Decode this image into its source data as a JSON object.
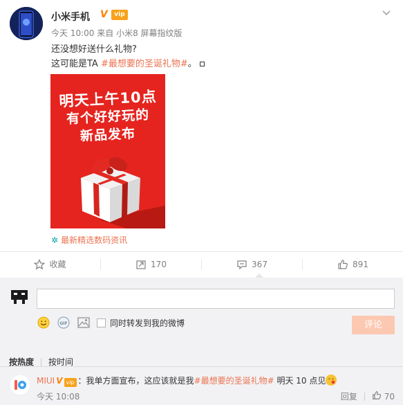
{
  "post": {
    "author": "小米手机",
    "verified_mark": "V",
    "vip_label": "vip",
    "meta_time": "今天 10:00",
    "meta_from": "来自",
    "meta_source": "小米8 屏幕指纹版",
    "text_line1": "还没想好送什么礼物?",
    "text_line2_prefix": "这可能是TA ",
    "topic": "#最想要的圣诞礼物#",
    "text_line2_suffix": "。",
    "image_lines": [
      "明天上午10点",
      "有个好好玩的",
      "新品发布"
    ],
    "image_source_icon": "✲",
    "image_source": "最新精选数码资讯"
  },
  "actions": {
    "favorite_label": "收藏",
    "repost_count": "170",
    "comment_count": "367",
    "like_count": "891"
  },
  "composer": {
    "input_value": "",
    "input_placeholder": "",
    "repost_label": "同时转发到我的微博",
    "submit_label": "评论"
  },
  "sort": {
    "hot_label": "按热度",
    "time_label": "按时间"
  },
  "comments": [
    {
      "user": "MIUI",
      "verified_mark": "V",
      "vip_label": "vip",
      "text_prefix": "：我单方面宣布，这应该就是我",
      "topic": "#最想要的圣诞礼物#",
      "text_suffix": " 明天 10 点见",
      "time": "今天 10:08",
      "reply_label": "回复",
      "like_count": "70"
    }
  ],
  "colors": {
    "accent": "#eb7350",
    "badge_orange": "#ff8200",
    "image_red": "#e5241f",
    "submit_disabled": "#fdc8b1"
  },
  "icons": [
    "chevron-down-icon",
    "star-icon",
    "repost-icon",
    "comment-icon",
    "thumbs-up-icon",
    "smile-icon",
    "gif-icon",
    "image-icon"
  ]
}
